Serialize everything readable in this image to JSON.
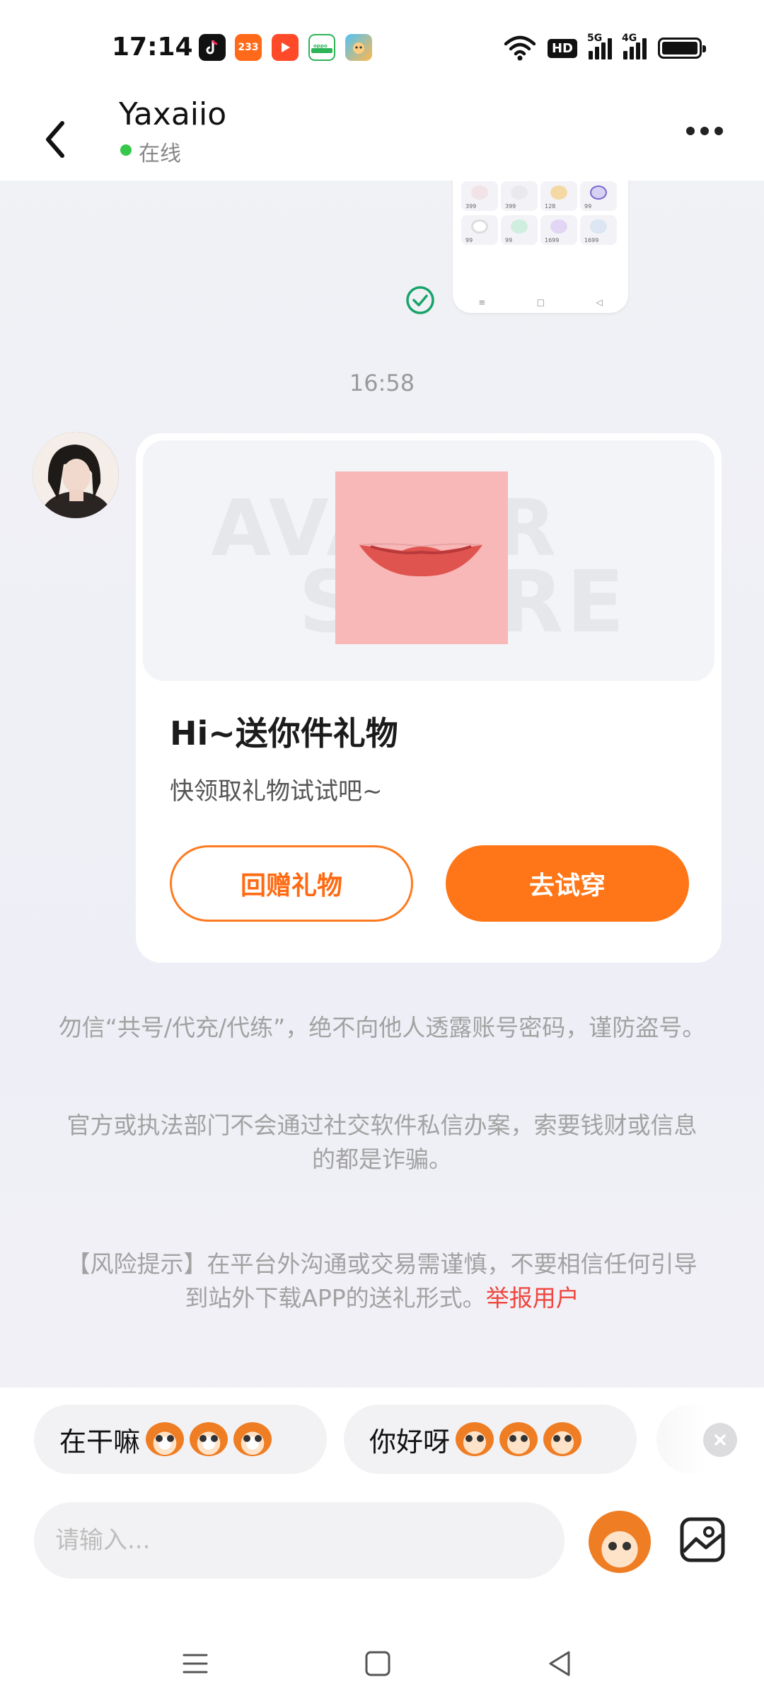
{
  "status_bar": {
    "time": "17:14",
    "app_icons": [
      "douyin-icon",
      "233-icon",
      "video-play-icon",
      "oppo-store-icon",
      "game-icon"
    ],
    "app_233_label": "233",
    "hd_label": "HD",
    "signal_5g": "5G",
    "signal_4g": "4G",
    "battery_level": 0.9
  },
  "header": {
    "contact_name": "Yaxaiio",
    "online_status": "在线"
  },
  "chat": {
    "timestamp": "16:58",
    "screenshot_prices": [
      "399",
      "399",
      "128",
      "99",
      "99",
      "99",
      "1699",
      "1699"
    ],
    "gift_card": {
      "watermark_line1": "AVATAR",
      "watermark_line2": "STORE",
      "title": "Hi~送你件礼物",
      "subtitle": "快领取礼物试试吧~",
      "return_gift_label": "回赠礼物",
      "try_on_label": "去试穿"
    },
    "notices": [
      "勿信“共号/代充/代练”，绝不向他人透露账号密码，谨防盗号。",
      "官方或执法部门不会通过社交软件私信办案，索要钱财或信息的都是诈骗。"
    ],
    "risk_notice": "【风险提示】在平台外沟通或交易需谨慎，不要相信任何引导到站外下载APP的送礼形式。",
    "report_link": "举报用户"
  },
  "quick_replies": [
    {
      "text": "在干嘛"
    },
    {
      "text": "你好呀"
    }
  ],
  "composer": {
    "placeholder": "请输入..."
  },
  "colors": {
    "accent": "#ff7618",
    "online": "#35c84a",
    "link_red": "#f0463e",
    "check_green": "#17a36a"
  }
}
